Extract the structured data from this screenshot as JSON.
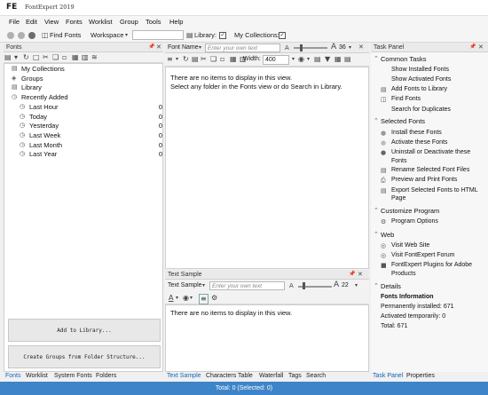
{
  "window": {
    "icon_text": "FE",
    "title": "FontExpert 2019"
  },
  "menu": [
    "File",
    "Edit",
    "View",
    "Fonts",
    "Worklist",
    "Group",
    "Tools",
    "Help"
  ],
  "toolbar": {
    "find_fonts": "Find Fonts",
    "workspace": "Workspace",
    "library_label": "Library:",
    "collections_label": "My Collections:"
  },
  "fonts_panel": {
    "title": "Fonts",
    "tree": [
      {
        "label": "My Collections",
        "count": ""
      },
      {
        "label": "Groups",
        "count": ""
      },
      {
        "label": "Library",
        "count": ""
      },
      {
        "label": "Recently Added",
        "count": ""
      },
      {
        "label": "Last Hour",
        "count": "0"
      },
      {
        "label": "Today",
        "count": "0"
      },
      {
        "label": "Yesterday",
        "count": "0"
      },
      {
        "label": "Last Week",
        "count": "0"
      },
      {
        "label": "Last Month",
        "count": "0"
      },
      {
        "label": "Last Year",
        "count": "0"
      }
    ],
    "add_to_library": "Add to Library...",
    "create_groups": "Create Groups from Folder Structure..."
  },
  "left_tabs": [
    "Fonts",
    "Worklist",
    "System Fonts",
    "Folders"
  ],
  "font_list": {
    "font_name_label": "Font Name",
    "font_name_placeholder": "Enter your own text",
    "size_value": "36",
    "width_label": "Width:",
    "width_value": "400",
    "empty_line1": "There are no items to display in this view.",
    "empty_line2": "Select any folder in the Fonts view or do Search in Library."
  },
  "text_sample": {
    "title": "Text Sample",
    "sample_label": "Text Sample",
    "placeholder": "Enter your own text",
    "size_value": "22",
    "empty": "There are no items to display in this view."
  },
  "center_tabs": [
    "Text Sample",
    "Characters Table",
    "Waterfall",
    "Tags",
    "Search"
  ],
  "task_panel": {
    "title": "Task Panel",
    "common_tasks": "Common Tasks",
    "common_items": [
      "Show Installed Fonts",
      "Show Activated Fonts",
      "Add Fonts to Library",
      "Find Fonts",
      "Search for Duplicates"
    ],
    "selected_fonts": "Selected Fonts",
    "selected_items": [
      "Install these Fonts",
      "Activate these Fonts",
      "Uninstall or Deactivate these",
      "Fonts",
      "Rename Selected Font Files",
      "Preview and Print Fonts",
      "Export Selected Fonts to HTML",
      "Page"
    ],
    "customize": "Customize Program",
    "customize_items": [
      "Program Options"
    ],
    "web": "Web",
    "web_items": [
      "Visit Web Site",
      "Visit FontExpert Forum",
      "FontExpert Plugins for Adobe",
      "Products"
    ],
    "details": "Details",
    "details_title": "Fonts Information",
    "details_lines": [
      "Permanently installed: 671",
      "Activated temporarily: 0",
      "Total: 671"
    ]
  },
  "right_tabs": [
    "Task Panel",
    "Properties"
  ],
  "status": "Total: 0 (Selected: 0)"
}
